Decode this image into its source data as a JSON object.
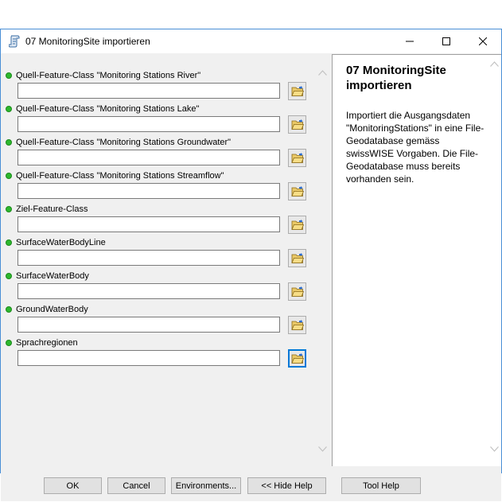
{
  "window": {
    "title": "07 MonitoringSite importieren",
    "icon": "script-tool-icon",
    "controls": [
      "minimize-icon",
      "maximize-icon",
      "close-icon"
    ]
  },
  "params": [
    {
      "label": "Quell-Feature-Class \"Monitoring Stations River\"",
      "value": ""
    },
    {
      "label": "Quell-Feature-Class \"Monitoring Stations Lake\"",
      "value": ""
    },
    {
      "label": "Quell-Feature-Class \"Monitoring Stations Groundwater\"",
      "value": ""
    },
    {
      "label": "Quell-Feature-Class \"Monitoring Stations Streamflow\"",
      "value": ""
    },
    {
      "label": "Ziel-Feature-Class",
      "value": ""
    },
    {
      "label": "SurfaceWaterBodyLine",
      "value": ""
    },
    {
      "label": "SurfaceWaterBody",
      "value": ""
    },
    {
      "label": "GroundWaterBody",
      "value": ""
    },
    {
      "label": "Sprachregionen",
      "value": ""
    }
  ],
  "help": {
    "title": "07 MonitoringSite importieren",
    "body": "Importiert die Ausgangsdaten \"MonitoringStations\" in eine File-Geodatabase gemäss swissWISE Vorgaben. Die File-Geodatabase muss bereits vorhanden sein."
  },
  "buttons": {
    "ok": "OK",
    "cancel": "Cancel",
    "environments": "Environments...",
    "hide_help": "<< Hide Help",
    "tool_help": "Tool Help"
  },
  "colors": {
    "required_dot": "#2eb82e",
    "window_border": "#4a8fd6",
    "focus": "#0078d7"
  }
}
